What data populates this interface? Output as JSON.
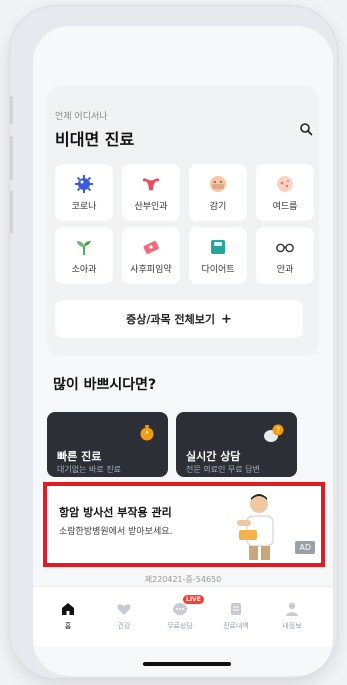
{
  "header": {
    "subtitle": "언제 어디서나",
    "title": "비대면 진료"
  },
  "categories": [
    {
      "label": "코로나",
      "icon": "virus-icon"
    },
    {
      "label": "산부인과",
      "icon": "uterus-icon"
    },
    {
      "label": "감기",
      "icon": "cold-icon"
    },
    {
      "label": "여드름",
      "icon": "acne-icon"
    },
    {
      "label": "소아과",
      "icon": "sprout-icon"
    },
    {
      "label": "사후피임약",
      "icon": "pill-icon"
    },
    {
      "label": "다이어트",
      "icon": "scale-icon"
    },
    {
      "label": "안과",
      "icon": "glasses-icon"
    }
  ],
  "view_all": {
    "label": "증상/과목 전체보기",
    "plus": "+"
  },
  "busy": {
    "heading": "많이 바쁘시다면?",
    "fast": {
      "title": "빠른 진료",
      "desc": "대기없는 바로 진료"
    },
    "live": {
      "title": "실시간 상담",
      "desc": "전문 의료인 무료 답변"
    }
  },
  "ad": {
    "title": "항암 방사선 부작용 관리",
    "subtitle": "소람한방병원에서 받아보세요.",
    "badge": "AD"
  },
  "certificate": "제220421-중-54650",
  "tabs": [
    {
      "label": "홈"
    },
    {
      "label": "건강"
    },
    {
      "label": "무료상담",
      "badge": "LIVE"
    },
    {
      "label": "진료내역"
    },
    {
      "label": "내정보"
    }
  ],
  "colors": {
    "accent_orange": "#f39c12",
    "highlight_red": "#e01b22",
    "dark_card": "#2c2f36"
  }
}
